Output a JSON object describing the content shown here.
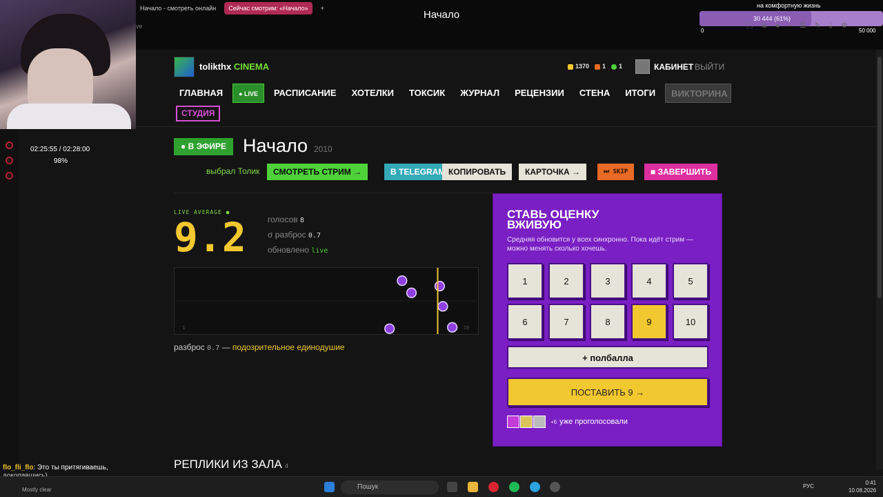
{
  "browser": {
    "tabs": [
      {
        "label": "Начало - смотреть онлайн",
        "active": false
      },
      {
        "label": "Сейчас смотрим: «Начало»",
        "active": true
      }
    ],
    "new_tab": "+",
    "address_fragment": "ve"
  },
  "stream": {
    "title": "Начало",
    "goal_label": "на комфортную жизнь",
    "goal_progress": "30 444 (61%)",
    "goal_fraction": 0.61,
    "goal_min": "0",
    "goal_max": "50 000",
    "timer": "02:25:55 / 02:28:00",
    "percent": "98%",
    "chat": {
      "user": "flo_fli_flo",
      "message": ": Это ты притягиваешь,",
      "message2": "докопавшись)",
      "weather": "Mostly clear"
    }
  },
  "site": {
    "logo_name": "tolikthx",
    "logo_accent": "CINEMA",
    "stats": {
      "coins": "1370",
      "streak": "1",
      "drops": "1"
    },
    "cabinet": "КАБИНЕТ",
    "logout": "ВЫЙТИ",
    "nav": [
      "ГЛАВНАЯ",
      "● LIVE",
      "РАСПИСАНИЕ",
      "ХОТЕЛКИ",
      "ТОКСИК",
      "ЖУРНАЛ",
      "РЕЦЕНЗИИ",
      "СТЕНА",
      "ИТОГИ",
      "ВИКТОРИНА"
    ],
    "studio": "СТУДИЯ"
  },
  "movie": {
    "on_air": "● В ЭФИРЕ",
    "title": "Начало",
    "year": "2010",
    "chosen_by": "выбрал Толик",
    "buttons": {
      "watch": "СМОТРЕТЬ СТРИМ →",
      "telegram": "В TELEGRAM",
      "copy": "КОПИРОВАТЬ",
      "card": "КАРТОЧКА →",
      "skip": "⏭ SKIP",
      "finish": "■ ЗАВЕРШИТЬ"
    }
  },
  "stats": {
    "live_label": "LIVE AVERAGE ●",
    "average": "9.2",
    "votes_label": "голосов",
    "votes": "8",
    "spread_label": "σ разброс",
    "spread": "0.7",
    "updated_label": "обновлено",
    "updated": "live",
    "axis_min": "1",
    "axis_max": "10",
    "note_prefix": "разброс",
    "note_value": "0.7",
    "note_sep": "—",
    "note_verdict": "подозрительное единодушие",
    "vote_points": [
      8.0,
      8.3,
      9.3,
      9.6,
      9.2,
      7.6
    ],
    "average_value": 9.2,
    "colors": {
      "accent": "#f2c830",
      "point": "#8f3fe0",
      "live": "#4fd13a"
    }
  },
  "rating": {
    "title": "СТАВЬ ОЦЕНКУ ВЖИВУЮ",
    "subtitle": "Средняя обновится у всех синхронно. Пока идёт стрим — можно менять сколько хочешь.",
    "options": [
      "1",
      "2",
      "3",
      "4",
      "5",
      "6",
      "7",
      "8",
      "9",
      "10"
    ],
    "selected": "9",
    "half": "+ полбалла",
    "submit": "ПОСТАВИТЬ 9 →",
    "voters_text": "уже проголосовали",
    "voters_extra": "+6",
    "panel_color": "#7a1fc4"
  },
  "replies": {
    "title": "РЕПЛИКИ ИЗ ЗАЛА",
    "count": "4"
  },
  "taskbar": {
    "search": "Пошук",
    "lang": "РУС",
    "time": "0:41",
    "date": "10.08.2026"
  }
}
